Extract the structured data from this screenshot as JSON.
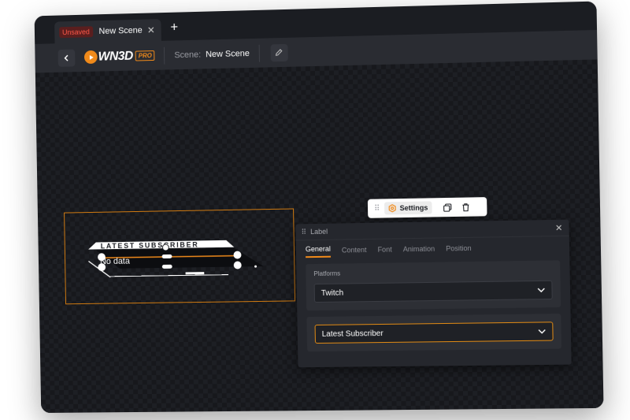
{
  "tab": {
    "badge": "Unsaved",
    "title": "New Scene",
    "close_glyph": "✕",
    "add_glyph": "+"
  },
  "toolbar": {
    "logo_text": "WN3D",
    "logo_badge": "PRO",
    "scene_label": "Scene:",
    "scene_name": "New Scene"
  },
  "widget": {
    "header": "LATEST SUBSCRIBER",
    "value": "No data"
  },
  "floating_toolbar": {
    "settings_label": "Settings"
  },
  "panel": {
    "title": "Label",
    "tabs": [
      "General",
      "Content",
      "Font",
      "Animation",
      "Position"
    ],
    "platforms_label": "Platforms",
    "platform_value": "Twitch",
    "type_value": "Latest Subscriber"
  },
  "colors": {
    "accent": "#f08a1a",
    "unsaved": "#ff5a4a",
    "canvas": "#17181c"
  },
  "icons": [
    "chevron-left-icon",
    "pencil-icon",
    "gear-icon",
    "duplicate-icon",
    "trash-icon",
    "drag-grip-icon",
    "chevron-down-icon",
    "close-icon",
    "plus-icon"
  ]
}
